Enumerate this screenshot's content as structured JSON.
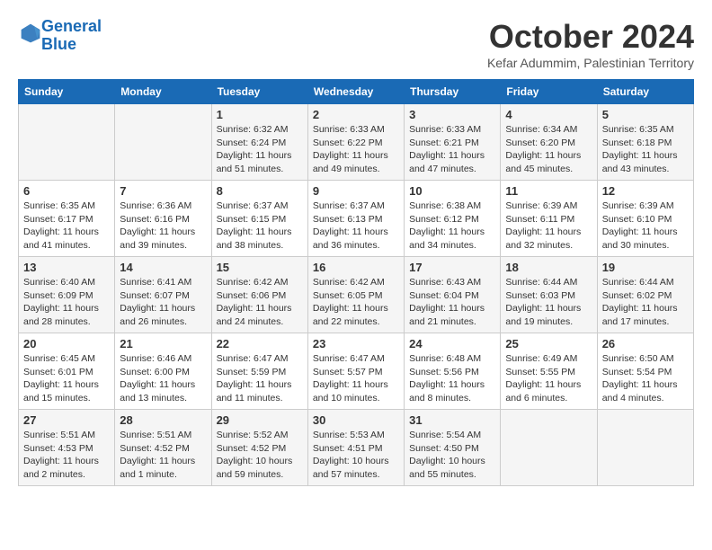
{
  "header": {
    "logo_line1": "General",
    "logo_line2": "Blue",
    "month_title": "October 2024",
    "subtitle": "Kefar Adummim, Palestinian Territory"
  },
  "days_of_week": [
    "Sunday",
    "Monday",
    "Tuesday",
    "Wednesday",
    "Thursday",
    "Friday",
    "Saturday"
  ],
  "weeks": [
    [
      {
        "day": "",
        "info": ""
      },
      {
        "day": "",
        "info": ""
      },
      {
        "day": "1",
        "info": "Sunrise: 6:32 AM\nSunset: 6:24 PM\nDaylight: 11 hours and 51 minutes."
      },
      {
        "day": "2",
        "info": "Sunrise: 6:33 AM\nSunset: 6:22 PM\nDaylight: 11 hours and 49 minutes."
      },
      {
        "day": "3",
        "info": "Sunrise: 6:33 AM\nSunset: 6:21 PM\nDaylight: 11 hours and 47 minutes."
      },
      {
        "day": "4",
        "info": "Sunrise: 6:34 AM\nSunset: 6:20 PM\nDaylight: 11 hours and 45 minutes."
      },
      {
        "day": "5",
        "info": "Sunrise: 6:35 AM\nSunset: 6:18 PM\nDaylight: 11 hours and 43 minutes."
      }
    ],
    [
      {
        "day": "6",
        "info": "Sunrise: 6:35 AM\nSunset: 6:17 PM\nDaylight: 11 hours and 41 minutes."
      },
      {
        "day": "7",
        "info": "Sunrise: 6:36 AM\nSunset: 6:16 PM\nDaylight: 11 hours and 39 minutes."
      },
      {
        "day": "8",
        "info": "Sunrise: 6:37 AM\nSunset: 6:15 PM\nDaylight: 11 hours and 38 minutes."
      },
      {
        "day": "9",
        "info": "Sunrise: 6:37 AM\nSunset: 6:13 PM\nDaylight: 11 hours and 36 minutes."
      },
      {
        "day": "10",
        "info": "Sunrise: 6:38 AM\nSunset: 6:12 PM\nDaylight: 11 hours and 34 minutes."
      },
      {
        "day": "11",
        "info": "Sunrise: 6:39 AM\nSunset: 6:11 PM\nDaylight: 11 hours and 32 minutes."
      },
      {
        "day": "12",
        "info": "Sunrise: 6:39 AM\nSunset: 6:10 PM\nDaylight: 11 hours and 30 minutes."
      }
    ],
    [
      {
        "day": "13",
        "info": "Sunrise: 6:40 AM\nSunset: 6:09 PM\nDaylight: 11 hours and 28 minutes."
      },
      {
        "day": "14",
        "info": "Sunrise: 6:41 AM\nSunset: 6:07 PM\nDaylight: 11 hours and 26 minutes."
      },
      {
        "day": "15",
        "info": "Sunrise: 6:42 AM\nSunset: 6:06 PM\nDaylight: 11 hours and 24 minutes."
      },
      {
        "day": "16",
        "info": "Sunrise: 6:42 AM\nSunset: 6:05 PM\nDaylight: 11 hours and 22 minutes."
      },
      {
        "day": "17",
        "info": "Sunrise: 6:43 AM\nSunset: 6:04 PM\nDaylight: 11 hours and 21 minutes."
      },
      {
        "day": "18",
        "info": "Sunrise: 6:44 AM\nSunset: 6:03 PM\nDaylight: 11 hours and 19 minutes."
      },
      {
        "day": "19",
        "info": "Sunrise: 6:44 AM\nSunset: 6:02 PM\nDaylight: 11 hours and 17 minutes."
      }
    ],
    [
      {
        "day": "20",
        "info": "Sunrise: 6:45 AM\nSunset: 6:01 PM\nDaylight: 11 hours and 15 minutes."
      },
      {
        "day": "21",
        "info": "Sunrise: 6:46 AM\nSunset: 6:00 PM\nDaylight: 11 hours and 13 minutes."
      },
      {
        "day": "22",
        "info": "Sunrise: 6:47 AM\nSunset: 5:59 PM\nDaylight: 11 hours and 11 minutes."
      },
      {
        "day": "23",
        "info": "Sunrise: 6:47 AM\nSunset: 5:57 PM\nDaylight: 11 hours and 10 minutes."
      },
      {
        "day": "24",
        "info": "Sunrise: 6:48 AM\nSunset: 5:56 PM\nDaylight: 11 hours and 8 minutes."
      },
      {
        "day": "25",
        "info": "Sunrise: 6:49 AM\nSunset: 5:55 PM\nDaylight: 11 hours and 6 minutes."
      },
      {
        "day": "26",
        "info": "Sunrise: 6:50 AM\nSunset: 5:54 PM\nDaylight: 11 hours and 4 minutes."
      }
    ],
    [
      {
        "day": "27",
        "info": "Sunrise: 5:51 AM\nSunset: 4:53 PM\nDaylight: 11 hours and 2 minutes."
      },
      {
        "day": "28",
        "info": "Sunrise: 5:51 AM\nSunset: 4:52 PM\nDaylight: 11 hours and 1 minute."
      },
      {
        "day": "29",
        "info": "Sunrise: 5:52 AM\nSunset: 4:52 PM\nDaylight: 10 hours and 59 minutes."
      },
      {
        "day": "30",
        "info": "Sunrise: 5:53 AM\nSunset: 4:51 PM\nDaylight: 10 hours and 57 minutes."
      },
      {
        "day": "31",
        "info": "Sunrise: 5:54 AM\nSunset: 4:50 PM\nDaylight: 10 hours and 55 minutes."
      },
      {
        "day": "",
        "info": ""
      },
      {
        "day": "",
        "info": ""
      }
    ]
  ]
}
